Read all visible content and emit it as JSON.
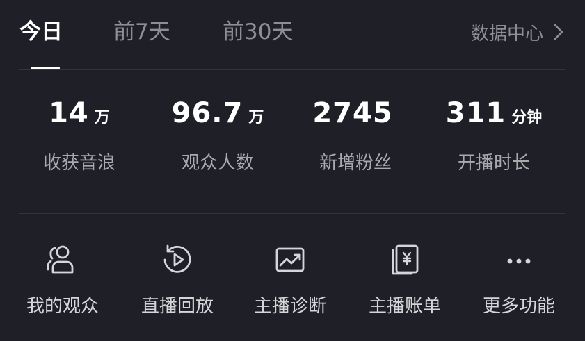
{
  "tabs": {
    "items": [
      {
        "label": "今日"
      },
      {
        "label": "前7天"
      },
      {
        "label": "前30天"
      }
    ],
    "active_index": 0
  },
  "data_center": {
    "label": "数据中心",
    "icon": "chevron-right-icon"
  },
  "stats": [
    {
      "value": "14",
      "unit": "万",
      "label": "收获音浪"
    },
    {
      "value": "96.7",
      "unit": "万",
      "label": "观众人数"
    },
    {
      "value": "2745",
      "unit": "",
      "label": "新增粉丝"
    },
    {
      "value": "311",
      "unit": "分钟",
      "label": "开播时长"
    }
  ],
  "actions": [
    {
      "label": "我的观众",
      "icon": "audience-icon"
    },
    {
      "label": "直播回放",
      "icon": "replay-icon"
    },
    {
      "label": "主播诊断",
      "icon": "diagnosis-icon"
    },
    {
      "label": "主播账单",
      "icon": "bill-icon"
    },
    {
      "label": "更多功能",
      "icon": "more-icon"
    }
  ],
  "colors": {
    "background": "#1f1f27",
    "text_primary": "#ffffff",
    "text_secondary": "#8e8e94",
    "divider": "#34343c"
  }
}
